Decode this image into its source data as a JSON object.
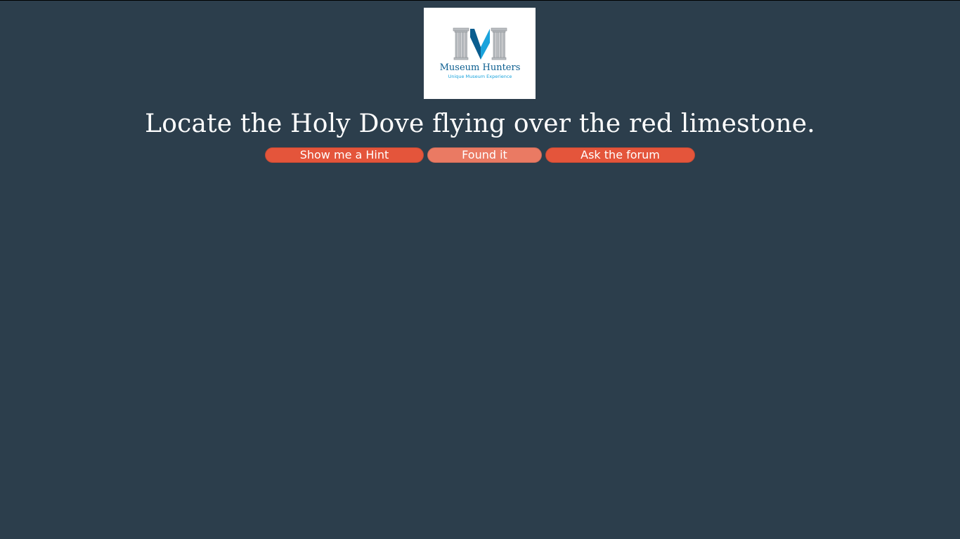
{
  "logo": {
    "brand": "Museum Hunters",
    "tagline": "Unique Museum Experience",
    "colors": {
      "pillar": "#b8bcc0",
      "accent_dark": "#0a5d8f",
      "accent_light": "#1aa3dc"
    }
  },
  "task": {
    "text": "Locate the Holy Dove flying over the red limestone."
  },
  "buttons": {
    "hint_label": "Show me a Hint",
    "found_label": "Found it",
    "forum_label": "Ask the forum"
  },
  "colors": {
    "background": "#2c3e4c",
    "button": "#e4553b",
    "button_light": "#ea7a63",
    "text": "#ffffff"
  }
}
